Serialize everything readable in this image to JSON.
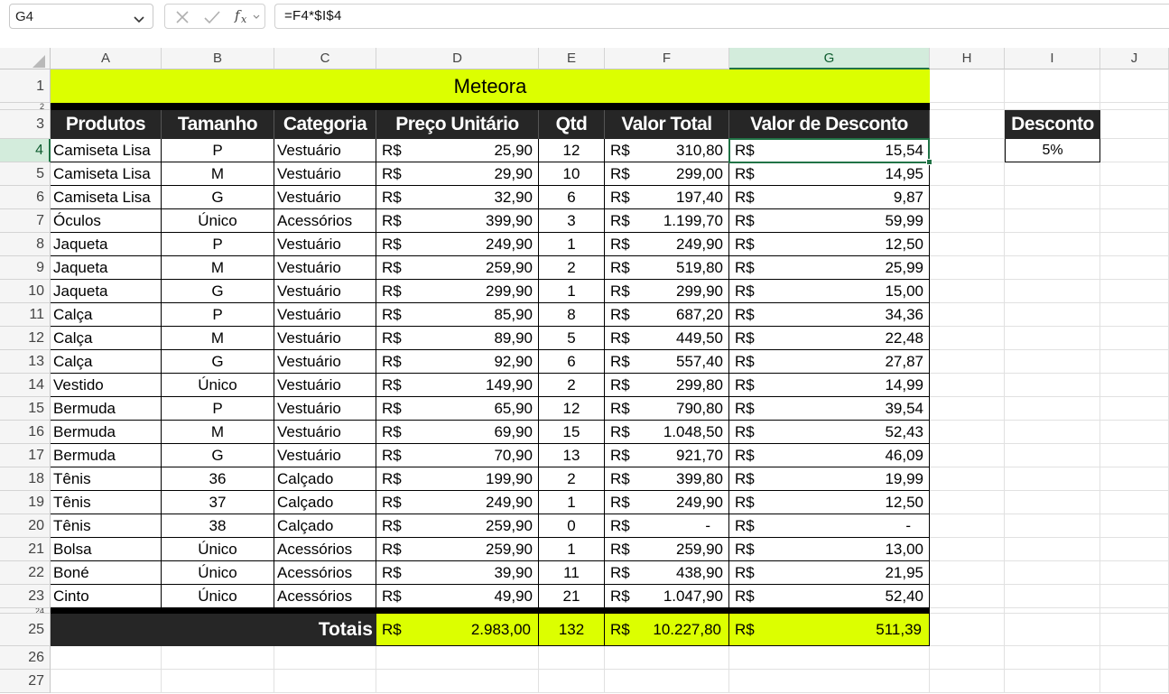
{
  "formula_bar": {
    "name_box": "G4",
    "formula": "=F4*$I$4"
  },
  "columns": [
    "A",
    "B",
    "C",
    "D",
    "E",
    "F",
    "G",
    "H",
    "I",
    "J"
  ],
  "rows": [
    "1",
    "2",
    "3",
    "4",
    "5",
    "6",
    "7",
    "8",
    "9",
    "10",
    "11",
    "12",
    "13",
    "14",
    "15",
    "16",
    "17",
    "18",
    "19",
    "20",
    "21",
    "22",
    "23",
    "24",
    "25",
    "26",
    "27"
  ],
  "selected_cell": "G4",
  "table": {
    "title": "Meteora",
    "headers": [
      "Produtos",
      "Tamanho",
      "Categoria",
      "Preço Unitário",
      "Qtd",
      "Valor Total",
      "Valor de Desconto"
    ],
    "currency": "R$",
    "rows": [
      [
        "Camiseta Lisa",
        "P",
        "Vestuário",
        "25,90",
        "12",
        "310,80",
        "15,54"
      ],
      [
        "Camiseta Lisa",
        "M",
        "Vestuário",
        "29,90",
        "10",
        "299,00",
        "14,95"
      ],
      [
        "Camiseta Lisa",
        "G",
        "Vestuário",
        "32,90",
        "6",
        "197,40",
        "9,87"
      ],
      [
        "Óculos",
        "Único",
        "Acessórios",
        "399,90",
        "3",
        "1.199,70",
        "59,99"
      ],
      [
        "Jaqueta",
        "P",
        "Vestuário",
        "249,90",
        "1",
        "249,90",
        "12,50"
      ],
      [
        "Jaqueta",
        "M",
        "Vestuário",
        "259,90",
        "2",
        "519,80",
        "25,99"
      ],
      [
        "Jaqueta",
        "G",
        "Vestuário",
        "299,90",
        "1",
        "299,90",
        "15,00"
      ],
      [
        "Calça",
        "P",
        "Vestuário",
        "85,90",
        "8",
        "687,20",
        "34,36"
      ],
      [
        "Calça",
        "M",
        "Vestuário",
        "89,90",
        "5",
        "449,50",
        "22,48"
      ],
      [
        "Calça",
        "G",
        "Vestuário",
        "92,90",
        "6",
        "557,40",
        "27,87"
      ],
      [
        "Vestido",
        "Único",
        "Vestuário",
        "149,90",
        "2",
        "299,80",
        "14,99"
      ],
      [
        "Bermuda",
        "P",
        "Vestuário",
        "65,90",
        "12",
        "790,80",
        "39,54"
      ],
      [
        "Bermuda",
        "M",
        "Vestuário",
        "69,90",
        "15",
        "1.048,50",
        "52,43"
      ],
      [
        "Bermuda",
        "G",
        "Vestuário",
        "70,90",
        "13",
        "921,70",
        "46,09"
      ],
      [
        "Tênis",
        "36",
        "Calçado",
        "199,90",
        "2",
        "399,80",
        "19,99"
      ],
      [
        "Tênis",
        "37",
        "Calçado",
        "249,90",
        "1",
        "249,90",
        "12,50"
      ],
      [
        "Tênis",
        "38",
        "Calçado",
        "259,90",
        "0",
        "-",
        "-"
      ],
      [
        "Bolsa",
        "Único",
        "Acessórios",
        "259,90",
        "1",
        "259,90",
        "13,00"
      ],
      [
        "Boné",
        "Único",
        "Acessórios",
        "39,90",
        "11",
        "438,90",
        "21,95"
      ],
      [
        "Cinto",
        "Único",
        "Acessórios",
        "49,90",
        "21",
        "1.047,90",
        "52,40"
      ]
    ],
    "totals": {
      "label": "Totais",
      "preco": "2.983,00",
      "qtd": "132",
      "valor_total": "10.227,80",
      "desconto": "511,39"
    }
  },
  "discount": {
    "header": "Desconto",
    "value": "5%"
  },
  "colors": {
    "accent_yellow": "#dcff00",
    "header_dark": "#262626",
    "selection_green": "#217346"
  }
}
